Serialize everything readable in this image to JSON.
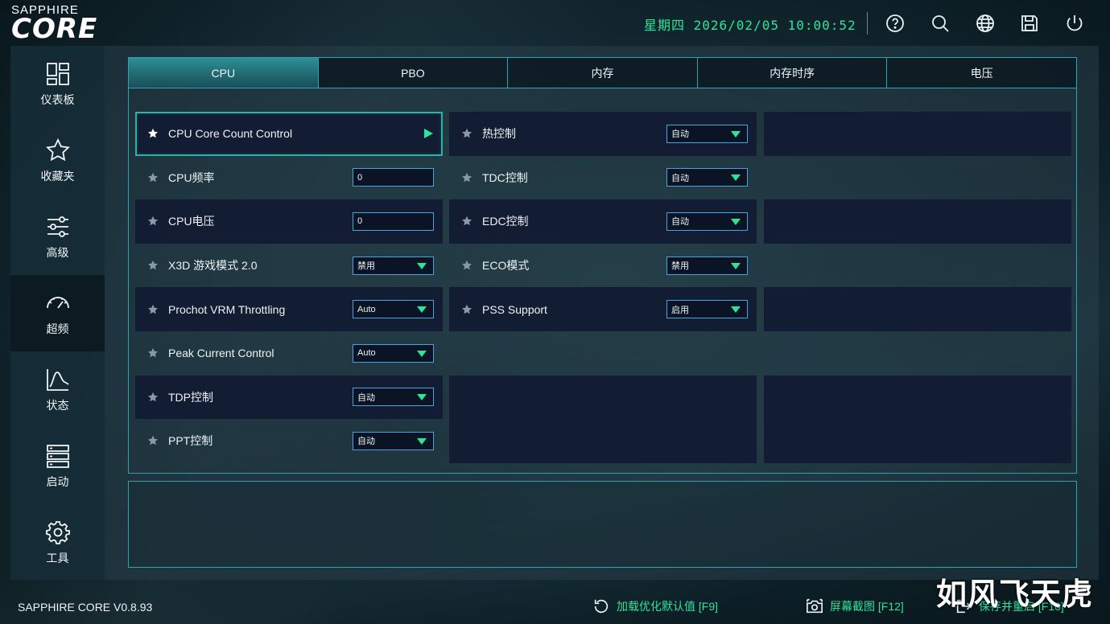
{
  "app": {
    "brand_small": "SAPPHIRE",
    "brand_big": "CORE",
    "version": "SAPPHIRE CORE V0.8.93"
  },
  "header": {
    "clock": "星期四 2026/02/05 10:00:52",
    "icons": [
      "help-icon",
      "search-icon",
      "globe-icon",
      "save-icon",
      "power-icon"
    ]
  },
  "sidebar": {
    "items": [
      {
        "label": "仪表板",
        "icon": "dashboard-icon"
      },
      {
        "label": "收藏夹",
        "icon": "star-icon"
      },
      {
        "label": "高级",
        "icon": "sliders-icon"
      },
      {
        "label": "超频",
        "icon": "speedometer-icon"
      },
      {
        "label": "状态",
        "icon": "chart-icon"
      },
      {
        "label": "启动",
        "icon": "storage-icon"
      },
      {
        "label": "工具",
        "icon": "gear-icon"
      }
    ],
    "active_index": 3
  },
  "tabs": [
    "CPU",
    "PBO",
    "内存",
    "内存时序",
    "电压"
  ],
  "active_tab": "CPU",
  "settings": {
    "col1": [
      {
        "label": "CPU Core Count Control",
        "type": "submenu",
        "selected": true
      },
      {
        "label": "CPU频率",
        "type": "input",
        "value": "0"
      },
      {
        "label": "CPU电压",
        "type": "input",
        "value": "0"
      },
      {
        "label": "X3D 游戏模式 2.0",
        "type": "dropdown",
        "value": "禁用"
      },
      {
        "label": "Prochot VRM Throttling",
        "type": "dropdown",
        "value": "Auto"
      },
      {
        "label": "Peak Current Control",
        "type": "dropdown",
        "value": "Auto"
      },
      {
        "label": "TDP控制",
        "type": "dropdown",
        "value": "自动"
      },
      {
        "label": "PPT控制",
        "type": "dropdown",
        "value": "自动"
      }
    ],
    "col2": [
      {
        "label": "热控制",
        "type": "dropdown",
        "value": "自动"
      },
      {
        "label": "TDC控制",
        "type": "dropdown",
        "value": "自动"
      },
      {
        "label": "EDC控制",
        "type": "dropdown",
        "value": "自动"
      },
      {
        "label": "ECO模式",
        "type": "dropdown",
        "value": "禁用"
      },
      {
        "label": "PSS Support",
        "type": "dropdown",
        "value": "启用"
      }
    ]
  },
  "footer": {
    "load_defaults": "加载优化默认值 [F9]",
    "screenshot": "屏幕截图 [F12]",
    "save_restart": "保存并重启 [F10]"
  },
  "watermark": "如风飞天虎",
  "colors": {
    "accent": "#2ee39a",
    "border": "#2aa5b8",
    "row_dark": "#121c33",
    "field_border": "#4aa3e0"
  }
}
